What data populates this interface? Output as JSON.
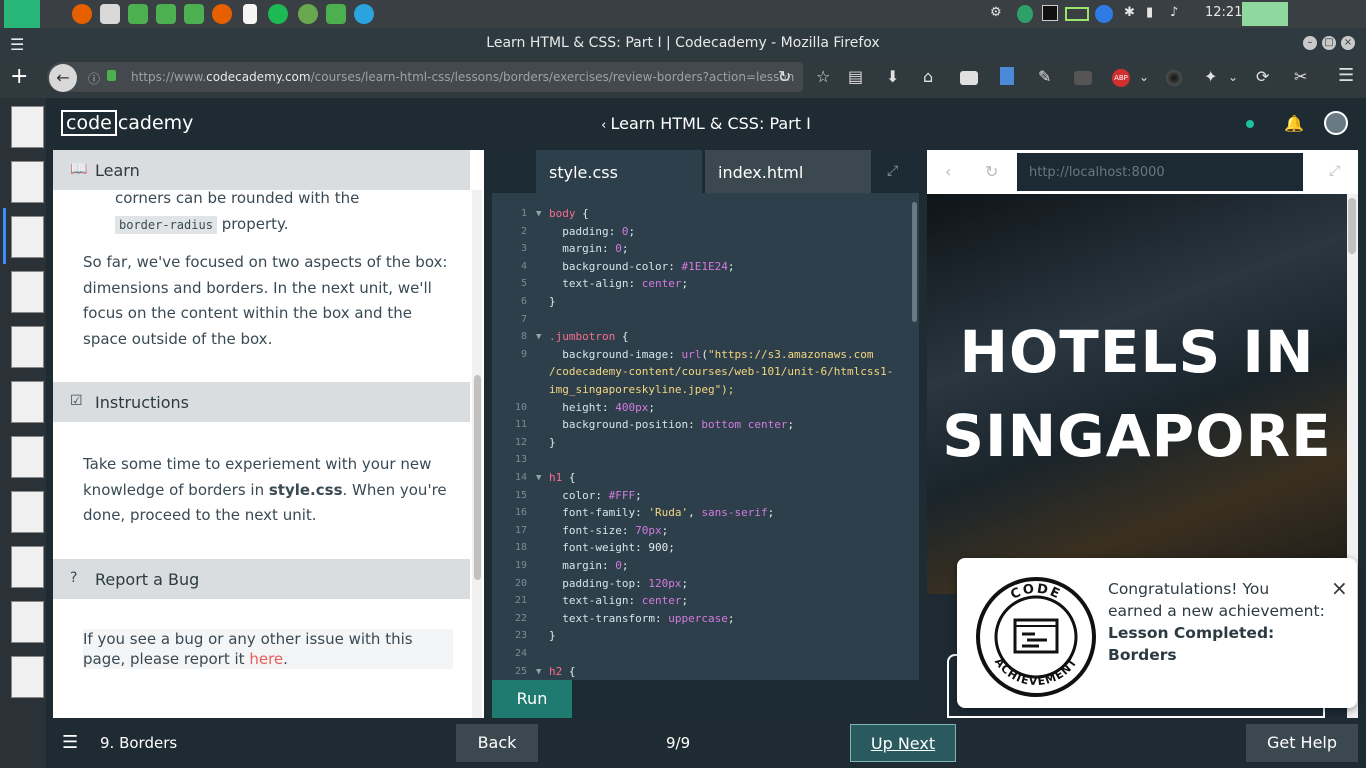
{
  "system": {
    "clock": "12:21"
  },
  "window": {
    "title": "Learn HTML & CSS: Part I | Codecademy - Mozilla Firefox"
  },
  "browser": {
    "url_prefix": "https://www.",
    "url_domain": "codecademy.com",
    "url_path": "/courses/learn-html-css/lessons/borders/exercises/review-borders?action=lesson",
    "abp_label": "ABP"
  },
  "app": {
    "logo_left": "code",
    "logo_right": "cademy",
    "course_title": "Learn HTML & CSS: Part I"
  },
  "learn": {
    "header": "Learn",
    "bullet_text_1": "corners can be rounded with the",
    "bullet_code": "border-radius",
    "bullet_text_2": "property.",
    "paragraph": "So far, we've focused on two aspects of the box: dimensions and borders. In the next unit, we'll focus on the content within the box and the space outside of the box.",
    "instructions_header": "Instructions",
    "instructions_pre": "Take some time to experiement with your new knowledge of borders in ",
    "instructions_bold": "style.css",
    "instructions_post": ". When you're done, proceed to the next unit.",
    "bug_header": "Report a Bug",
    "bug_pre": "If you see a bug or any other issue with this page, please report it ",
    "bug_link": "here",
    "bug_post": "."
  },
  "editor": {
    "tabs": [
      "style.css",
      "index.html"
    ],
    "run_label": "Run",
    "lines": [
      {
        "n": "1",
        "fold": true,
        "code": "body {"
      },
      {
        "n": "2",
        "code": "  padding: 0;"
      },
      {
        "n": "3",
        "code": "  margin: 0;"
      },
      {
        "n": "4",
        "code": "  background-color: #1E1E24;"
      },
      {
        "n": "5",
        "code": "  text-align: center;"
      },
      {
        "n": "6",
        "code": "}"
      },
      {
        "n": "7",
        "code": ""
      },
      {
        "n": "8",
        "fold": true,
        "code": ".jumbotron {"
      },
      {
        "n": "9",
        "code": "  background-image: url(\"https://s3.amazonaws.com"
      },
      {
        "n": "",
        "code": "/codecademy-content/courses/web-101/unit-6/htmlcss1-"
      },
      {
        "n": "",
        "code": "img_singaporeskyline.jpeg\");"
      },
      {
        "n": "10",
        "code": "  height: 400px;"
      },
      {
        "n": "11",
        "code": "  background-position: bottom center;"
      },
      {
        "n": "12",
        "code": "}"
      },
      {
        "n": "13",
        "code": ""
      },
      {
        "n": "14",
        "fold": true,
        "code": "h1 {"
      },
      {
        "n": "15",
        "code": "  color: #FFF;"
      },
      {
        "n": "16",
        "code": "  font-family: 'Ruda', sans-serif;"
      },
      {
        "n": "17",
        "code": "  font-size: 70px;"
      },
      {
        "n": "18",
        "code": "  font-weight: 900;"
      },
      {
        "n": "19",
        "code": "  margin: 0;"
      },
      {
        "n": "20",
        "code": "  padding-top: 120px;"
      },
      {
        "n": "21",
        "code": "  text-align: center;"
      },
      {
        "n": "22",
        "code": "  text-transform: uppercase;"
      },
      {
        "n": "23",
        "code": "}"
      },
      {
        "n": "24",
        "code": ""
      },
      {
        "n": "25",
        "fold": true,
        "code": "h2 {"
      }
    ]
  },
  "preview": {
    "url": "http://localhost:8000",
    "hero_text": "HOTELS IN SINGAPORE"
  },
  "achievement": {
    "badge_top": "CODE",
    "badge_bottom": "ACHIEVEMENT",
    "line1": "Congratulations! You earned a new achievement:",
    "name": "Lesson Completed: Borders"
  },
  "footer": {
    "lesson": "9. Borders",
    "back": "Back",
    "progress": "9/9",
    "next": "Up Next",
    "help": "Get Help"
  }
}
